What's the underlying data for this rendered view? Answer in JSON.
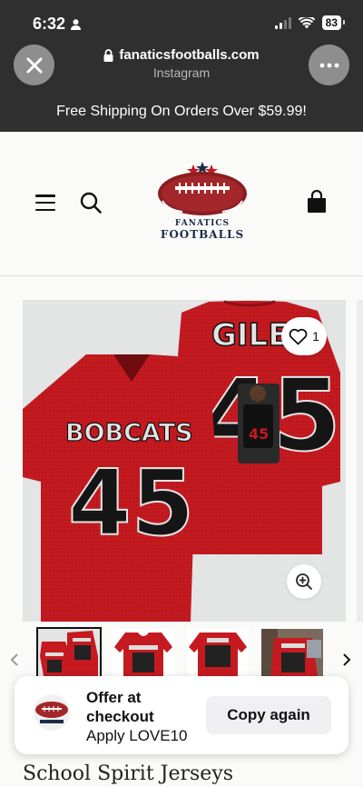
{
  "status": {
    "time": "6:32",
    "battery": "83"
  },
  "browser": {
    "domain": "fanaticsfootballs.com",
    "source": "Instagram"
  },
  "promo": {
    "text": "Free Shipping On Orders Over $59.99!"
  },
  "logo": {
    "line1": "FANATICS",
    "line2": "FOOTBALLS"
  },
  "product": {
    "wishlist_count": "1",
    "title": "School Spirit Jerseys",
    "front_team": "BOBCATS",
    "front_number": "45",
    "back_name": "GILES",
    "back_number": "45",
    "thumb_count": 4
  },
  "toast": {
    "line1": "Offer at",
    "line2": "checkout",
    "line3": "Apply LOVE10",
    "copy_label": "Copy again"
  },
  "colors": {
    "chrome": "#2f2f2f",
    "jersey_red": "#c41a20",
    "accent_navy": "#1f2a4a"
  }
}
